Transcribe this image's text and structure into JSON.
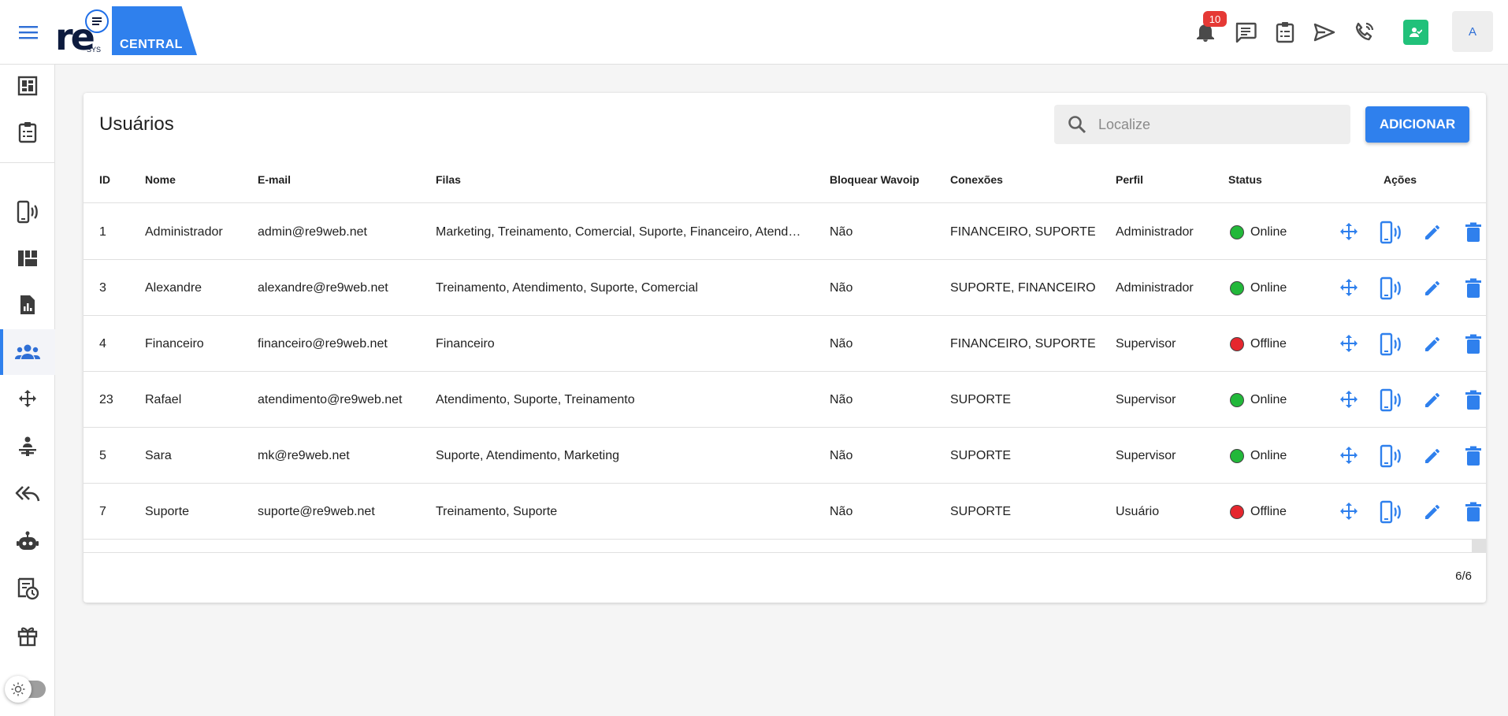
{
  "header": {
    "logo_text": "re",
    "logo_sub": "SYS",
    "logo_badge": "CENTRAL",
    "notifications_count": "10",
    "avatar_initial": "A",
    "icons": [
      "menu-icon",
      "bell-icon",
      "chat-icon",
      "clipboard-icon",
      "send-icon",
      "phone-icon",
      "contact-icon"
    ]
  },
  "sidebar": {
    "items": [
      {
        "name": "dashboard-icon"
      },
      {
        "name": "tasks-icon"
      },
      {
        "name": "connections-icon"
      },
      {
        "name": "panel-icon"
      },
      {
        "name": "reports-icon"
      },
      {
        "name": "users-icon",
        "active": true
      },
      {
        "name": "queues-icon"
      },
      {
        "name": "attendance-icon"
      },
      {
        "name": "quick-replies-icon"
      },
      {
        "name": "bot-icon"
      },
      {
        "name": "schedule-icon"
      },
      {
        "name": "gift-icon"
      }
    ]
  },
  "main": {
    "title": "Usuários",
    "search_placeholder": "Localize",
    "add_label": "ADICIONAR",
    "columns": [
      "ID",
      "Nome",
      "E-mail",
      "Filas",
      "Bloquear Wavoip",
      "Conexões",
      "Perfil",
      "Status",
      "Ações"
    ],
    "rows": [
      {
        "id": "1",
        "name": "Administrador",
        "email": "admin@re9web.net",
        "queues": "Marketing, Treinamento, Comercial, Suporte, Financeiro, Atend…",
        "block": "Não",
        "connections": "FINANCEIRO, SUPORTE",
        "profile": "Administrador",
        "status": "Online"
      },
      {
        "id": "3",
        "name": "Alexandre",
        "email": "alexandre@re9web.net",
        "queues": "Treinamento, Atendimento, Suporte, Comercial",
        "block": "Não",
        "connections": "SUPORTE, FINANCEIRO",
        "profile": "Administrador",
        "status": "Online"
      },
      {
        "id": "4",
        "name": "Financeiro",
        "email": "financeiro@re9web.net",
        "queues": "Financeiro",
        "block": "Não",
        "connections": "FINANCEIRO, SUPORTE",
        "profile": "Supervisor",
        "status": "Offline"
      },
      {
        "id": "23",
        "name": "Rafael",
        "email": "atendimento@re9web.net",
        "queues": "Atendimento, Suporte, Treinamento",
        "block": "Não",
        "connections": "SUPORTE",
        "profile": "Supervisor",
        "status": "Online"
      },
      {
        "id": "5",
        "name": "Sara",
        "email": "mk@re9web.net",
        "queues": "Suporte, Atendimento, Marketing",
        "block": "Não",
        "connections": "SUPORTE",
        "profile": "Supervisor",
        "status": "Online"
      },
      {
        "id": "7",
        "name": "Suporte",
        "email": "suporte@re9web.net",
        "queues": "Treinamento, Suporte",
        "block": "Não",
        "connections": "SUPORTE",
        "profile": "Usuário",
        "status": "Offline"
      }
    ],
    "pagination": "6/6"
  },
  "colors": {
    "primary": "#2f80ed",
    "online": "#22b83a",
    "offline": "#e5262e",
    "badge": "#e53935",
    "whatsapp_green": "#21c17a"
  }
}
